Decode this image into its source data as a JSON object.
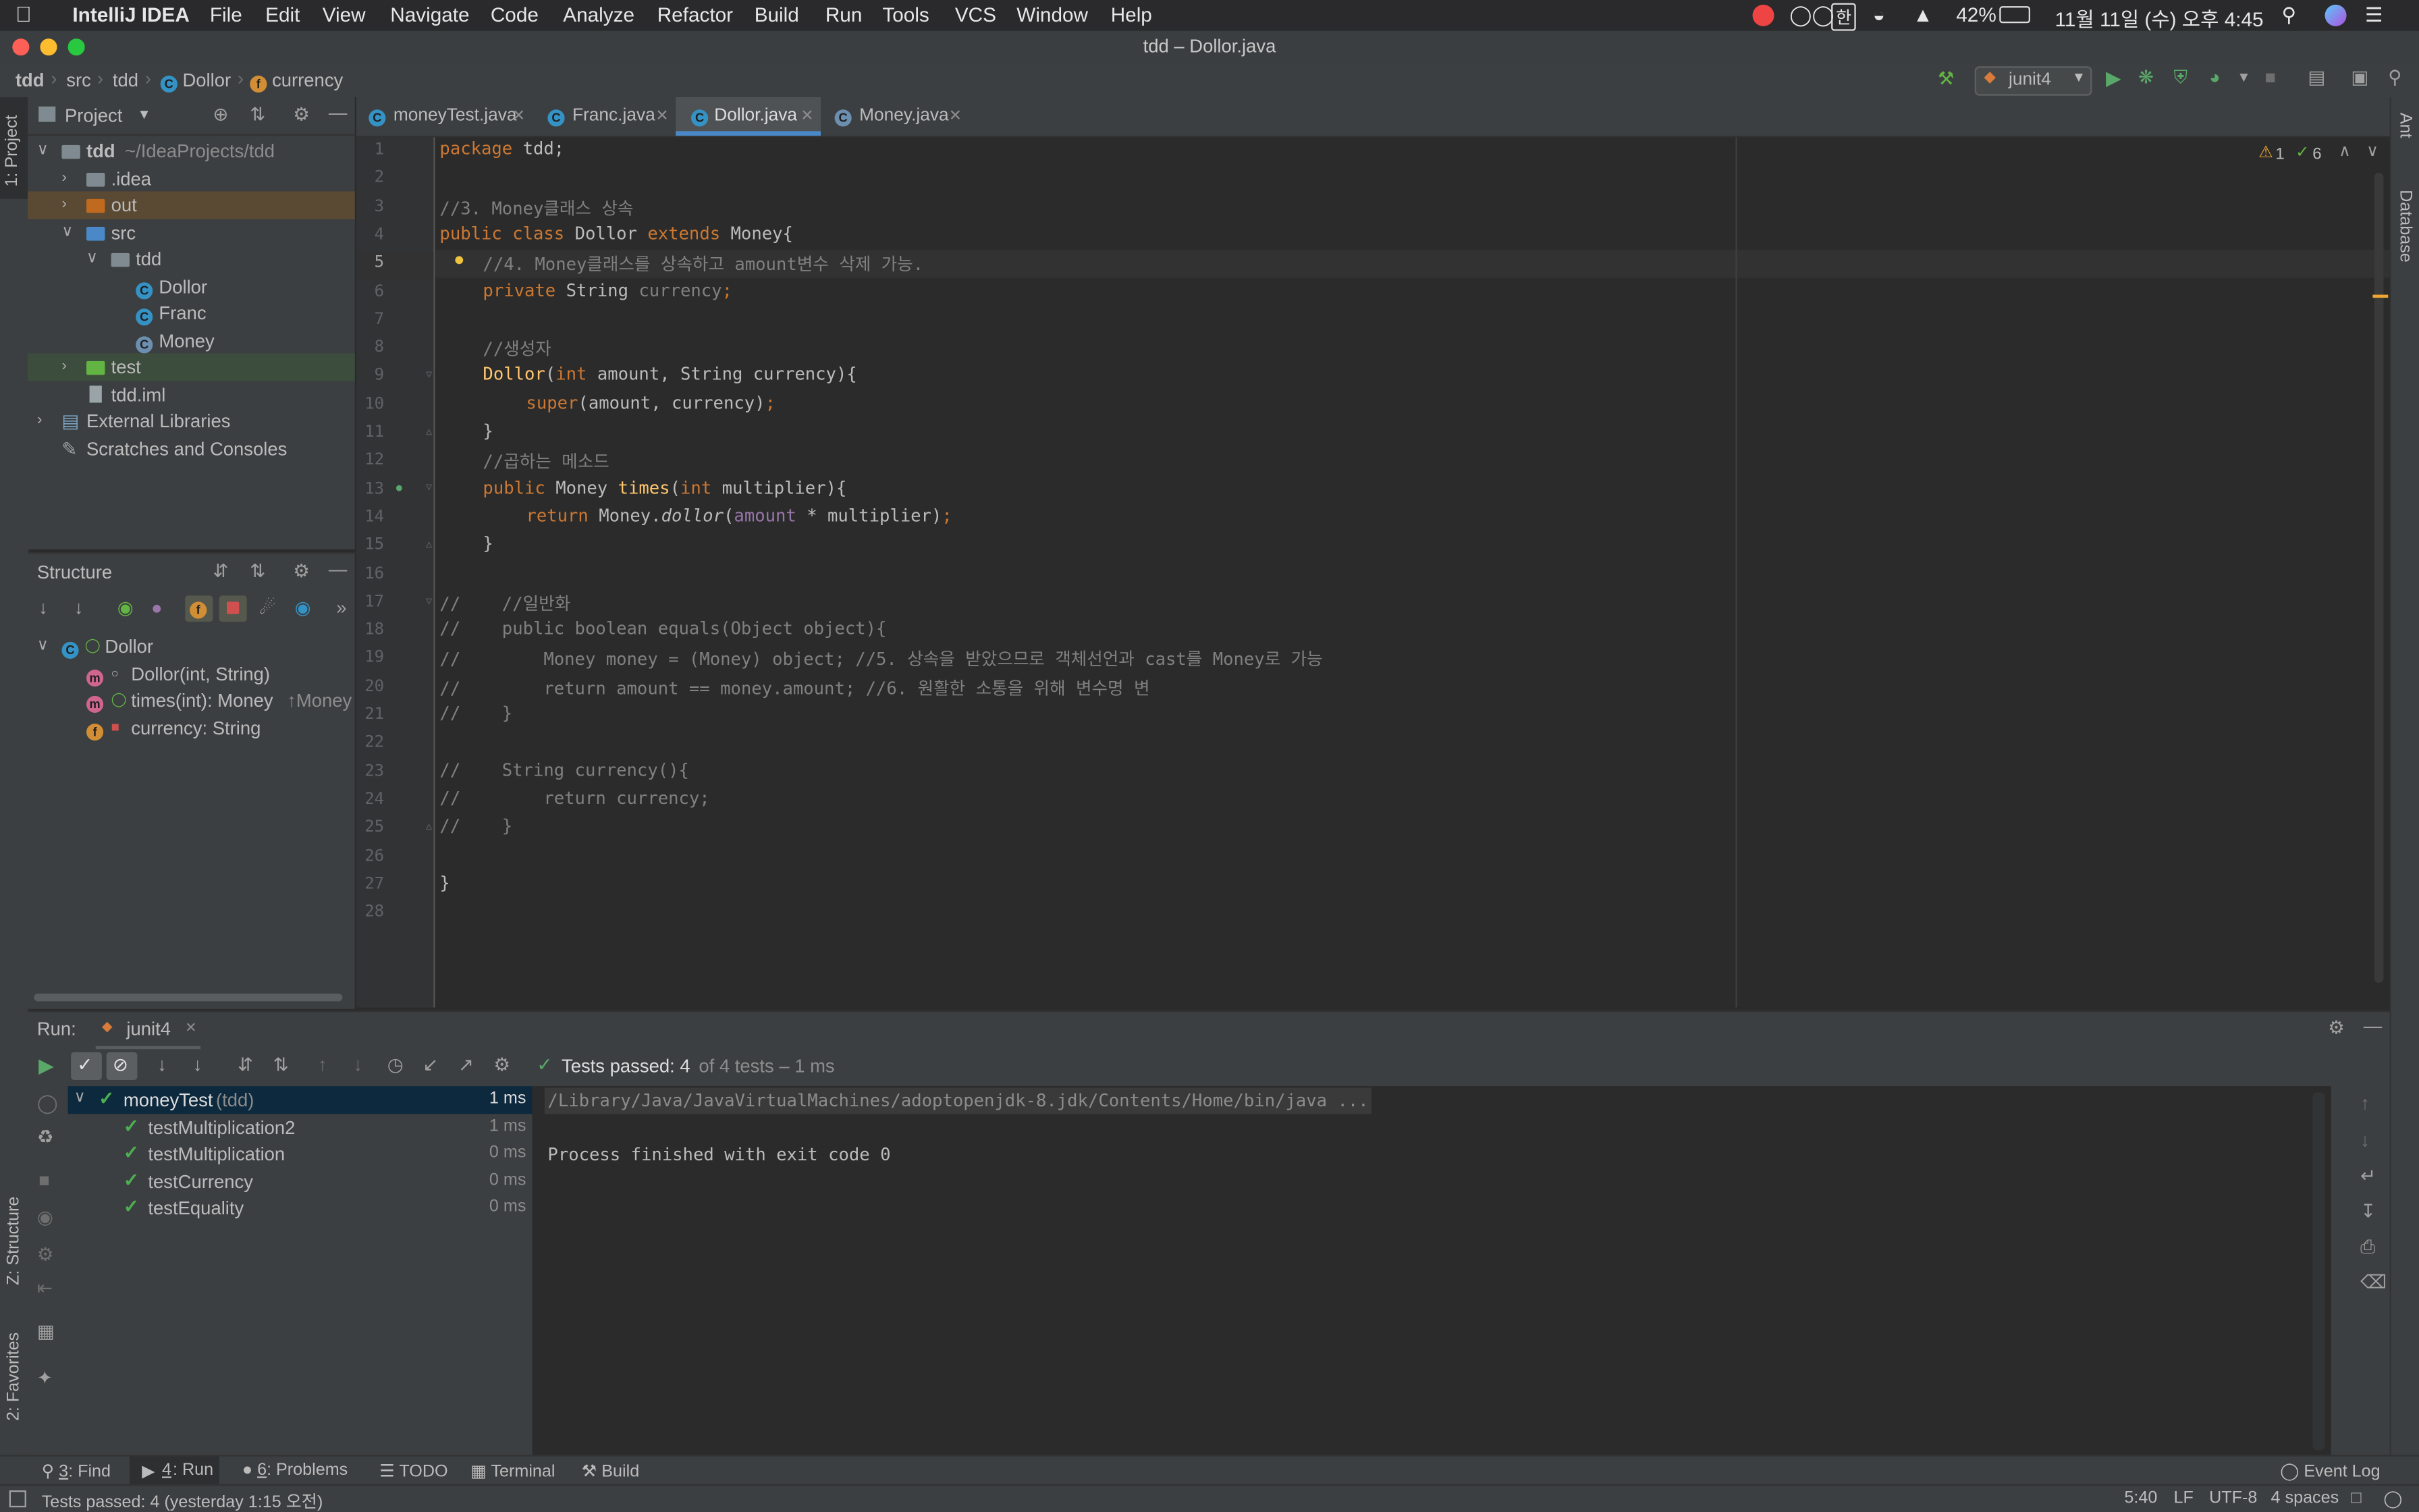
{
  "macbar": {
    "app_name": "IntelliJ IDEA",
    "menus": [
      "File",
      "Edit",
      "View",
      "Navigate",
      "Code",
      "Analyze",
      "Refactor",
      "Build",
      "Run",
      "Tools",
      "VCS",
      "Window",
      "Help"
    ],
    "ime": "한",
    "battery": "42%",
    "clock": "11월 11일 (수) 오후 4:45"
  },
  "window": {
    "title": "tdd – Dollor.java"
  },
  "breadcrumb": [
    "tdd",
    "src",
    "tdd",
    "Dollor",
    "currency"
  ],
  "run_config": "junit4",
  "project_panel": {
    "title": "Project",
    "root_name": "tdd",
    "root_path": "~/IdeaProjects/tdd",
    "items": [
      ".idea",
      "out",
      "src",
      "tdd",
      "Dollor",
      "Franc",
      "Money",
      "test",
      "tdd.iml",
      "External Libraries",
      "Scratches and Consoles"
    ]
  },
  "structure_panel": {
    "title": "Structure",
    "class_name": "Dollor",
    "members": [
      "Dollor(int, String)",
      "times(int): Money",
      "currency: String"
    ],
    "times_suffix": "↑Money"
  },
  "editor": {
    "tabs": [
      "moneyTest.java",
      "Franc.java",
      "Dollor.java",
      "Money.java"
    ],
    "active_tab": "Dollor.java",
    "warnings": "1",
    "weak_warnings": "6",
    "line_numbers": [
      "1",
      "2",
      "3",
      "4",
      "5",
      "6",
      "7",
      "8",
      "9",
      "10",
      "11",
      "12",
      "13",
      "14",
      "15",
      "16",
      "17",
      "18",
      "19",
      "20",
      "21",
      "22",
      "23",
      "24",
      "25",
      "26",
      "27",
      "28"
    ],
    "code": {
      "l1_kw": "package",
      "l1_rest": " tdd;",
      "l3": "//3. Money클래스 상속",
      "l4_kw1": "public class",
      "l4_name": " Dollor ",
      "l4_kw2": "extends",
      "l4_rest": " Money{",
      "l5": "//4. Money클래스를 상속하고 amount변수 삭제 가능.",
      "l6_kw": "private",
      "l6_type": " String ",
      "l6_field": "currency",
      "l6_end": ";",
      "l8": "//생성자",
      "l9_fn": "Dollor",
      "l9_open": "(",
      "l9_kw": "int",
      "l9_rest": " amount, String currency){",
      "l10_kw": "super",
      "l10_rest": "(amount, currency)",
      "l10_semi": ";",
      "l11": "}",
      "l12": "//곱하는 메소드",
      "l13_kw": "public",
      "l13_type": " Money ",
      "l13_fn": "times",
      "l13_open": "(",
      "l13_kw2": "int",
      "l13_rest": " multiplier){",
      "l14_kw": "return",
      "l14_a": " Money.",
      "l14_method": "dollor",
      "l14_open": "(",
      "l14_field": "amount",
      "l14_rest": " * multiplier)",
      "l14_semi": ";",
      "l15": "}",
      "l17": "//    //일반화",
      "l18": "//    public boolean equals(Object object){",
      "l19": "//        Money money = (Money) object; //5. 상속을 받았으므로 객체선언과 cast를 Money로 가능",
      "l20": "//        return amount == money.amount; //6. 원활한 소통을 위해 변수명 변",
      "l21": "//    }",
      "l23": "//    String currency(){",
      "l24": "//        return currency;",
      "l25": "//    }",
      "l27": "}"
    }
  },
  "run_panel": {
    "label": "Run:",
    "config_tab": "junit4",
    "status_bold": "Tests passed: 4",
    "status_rest": " of 4 tests – 1 ms",
    "suite_name": "moneyTest",
    "suite_pkg": " (tdd)",
    "suite_time": "1 ms",
    "tests": [
      {
        "name": "testMultiplication2",
        "time": "1 ms"
      },
      {
        "name": "testMultiplication",
        "time": "0 ms"
      },
      {
        "name": "testCurrency",
        "time": "0 ms"
      },
      {
        "name": "testEquality",
        "time": "0 ms"
      }
    ],
    "console_cmd": "/Library/Java/JavaVirtualMachines/adoptopenjdk-8.jdk/Contents/Home/bin/java ...",
    "console_exit": "Process finished with exit code 0"
  },
  "side_tabs": {
    "project": "1: Project",
    "structure": "Z: Structure",
    "favorites": "2: Favorites",
    "ant": "Ant",
    "database": "Database"
  },
  "bottom_tools": {
    "find_num": "3",
    "find": ": Find",
    "run_num": "4",
    "run": ": Run",
    "problems_num": "6",
    "problems": ": Problems",
    "todo": "TODO",
    "terminal": "Terminal",
    "build": "Build",
    "event_log": "Event Log"
  },
  "status_bar": {
    "message": "Tests passed: 4 (yesterday 1:15 오전)",
    "position": "5:40",
    "line_sep": "LF",
    "encoding": "UTF-8",
    "indent": "4 spaces"
  },
  "colors": {
    "editor_bg": "#2b2b2b",
    "panel_bg": "#3c3f41",
    "keyword": "#cc7832",
    "comment": "#808080",
    "function": "#ffc66d",
    "field": "#9876aa",
    "pass_green": "#4caf50"
  }
}
